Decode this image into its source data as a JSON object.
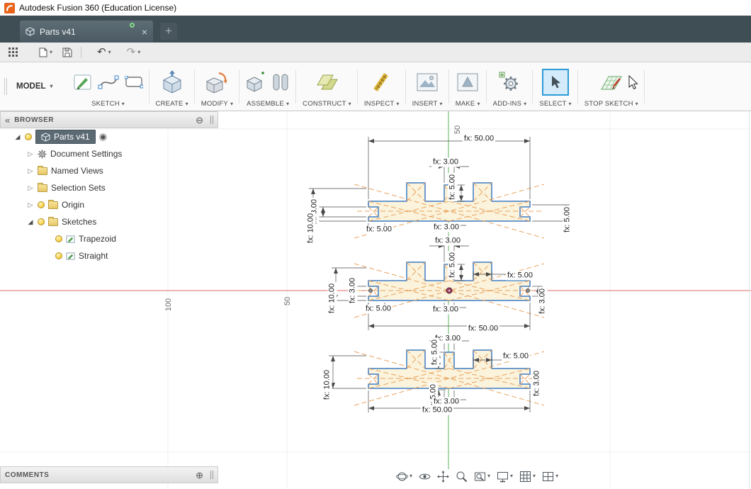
{
  "title_bar": {
    "app_title": "Autodesk Fusion 360 (Education License)"
  },
  "tab_bar": {
    "tab_label": "Parts v41"
  },
  "icons": {
    "caret_down": "▾",
    "undo": "↶",
    "redo": "↷",
    "close": "×",
    "new_tab": "+",
    "collapse_left": "«",
    "minus_circle": "⊖",
    "plus_circle": "⊕",
    "expander_closed": "▷",
    "expander_open": "◢",
    "target": "◉"
  },
  "ribbon": {
    "workspace_label": "MODEL",
    "groups": [
      {
        "label": "SKETCH"
      },
      {
        "label": "CREATE"
      },
      {
        "label": "MODIFY"
      },
      {
        "label": "ASSEMBLE"
      },
      {
        "label": "CONSTRUCT"
      },
      {
        "label": "INSPECT"
      },
      {
        "label": "INSERT"
      },
      {
        "label": "MAKE"
      },
      {
        "label": "ADD-INS"
      },
      {
        "label": "SELECT"
      },
      {
        "label": "STOP SKETCH"
      }
    ]
  },
  "browser": {
    "header": "BROWSER",
    "items": [
      {
        "label": "Parts v41"
      },
      {
        "label": "Document Settings"
      },
      {
        "label": "Named Views"
      },
      {
        "label": "Selection Sets"
      },
      {
        "label": "Origin"
      },
      {
        "label": "Sketches"
      },
      {
        "label": "Trapezoid"
      },
      {
        "label": "Straight"
      }
    ]
  },
  "comments": {
    "header": "COMMENTS"
  },
  "canvas": {
    "grid_labels": [
      "50",
      "100",
      "50"
    ],
    "dims": [
      "fx: 50.00",
      "fx: 3.00",
      "fx: 5.00",
      "fx: 3.00",
      "fx: 10.00",
      "fx: 5.00",
      "fx: 3.00",
      "fx: 5.00",
      "fx: 3.00",
      "fx: 5.00",
      "fx: 5.00",
      "fx: 3.00",
      "fx: 10.00",
      "fx: 5.00",
      "fx: 3.00",
      "fx: 3.00",
      "fx: 50.00",
      "fx: 3.00",
      "fx: 5.00",
      "fx: 5.00",
      "fx: 10.00",
      "fx: 3.00",
      "fx: 5.00",
      "fx: 3.00",
      "fx: 50.00"
    ]
  },
  "colors": {
    "sketch_line": "#3e7cc1",
    "construction_line": "#e9a45f",
    "profile_fill": "#fbf3dc",
    "axis_x": "#e06868",
    "axis_y": "#8cc98c",
    "selection_highlight": "#2e9bd6"
  }
}
